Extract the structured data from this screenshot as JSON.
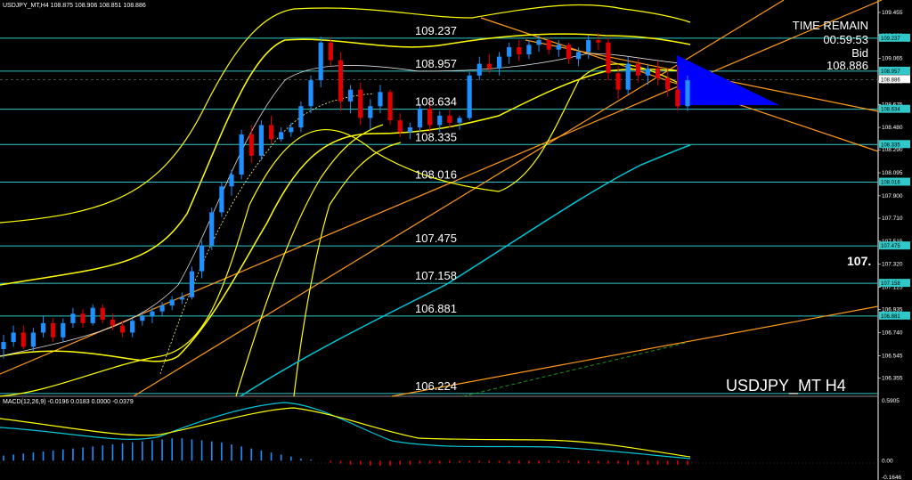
{
  "header": {
    "title": "USDJPY_MT,H4  108.875 108.906 108.851 108.886",
    "macd_label": "MACD(12,26,9) -0.0196 0.0183 0.0000 -0.0379"
  },
  "info_panel": {
    "time_remain_label": "TIME REMAIN",
    "time_remain_value": "00:59:53",
    "bid_label": "Bid",
    "bid_value": "108.886"
  },
  "symbol_watermark": "USDJPY_MT H4",
  "big_label": "107.",
  "colors": {
    "background": "#000000",
    "bull": "#1e90ff",
    "bear": "#e00000",
    "level_line": "#30c8c8",
    "band": "#ffff00",
    "trend": "#ff9a1a",
    "ma_cyan": "#00c8d8",
    "triangle": "#0000ff"
  },
  "chart_data": {
    "type": "line",
    "title": "USDJPY_MT H4",
    "y_range": [
      106.2,
      109.5
    ],
    "macd_range": [
      -0.1646,
      0.5905
    ],
    "price_axis_ticks": [
      "109.455",
      "109.260",
      "109.065",
      "108.870",
      "108.675",
      "108.480",
      "108.290",
      "108.095",
      "107.900",
      "107.710",
      "107.515",
      "107.320",
      "107.125",
      "106.935",
      "106.740",
      "106.545",
      "106.355"
    ],
    "macd_axis_ticks": [
      "0.5905",
      "0.00",
      "-0.1646"
    ],
    "levels": [
      {
        "value": 109.237,
        "label": "109.237",
        "tag": "109.237"
      },
      {
        "value": 108.957,
        "label": "108.957",
        "tag": "108.957"
      },
      {
        "value": 108.634,
        "label": "108.634",
        "tag": "108.634"
      },
      {
        "value": 108.335,
        "label": "108.335",
        "tag": "108.335"
      },
      {
        "value": 108.016,
        "label": "108.016",
        "tag": "108.016"
      },
      {
        "value": 107.475,
        "label": "107.475",
        "tag": "107.475"
      },
      {
        "value": 107.158,
        "label": "107.158",
        "tag": "107.158"
      },
      {
        "value": 106.881,
        "label": "106.881",
        "tag": "106.881"
      },
      {
        "value": 106.224,
        "label": "106.224",
        "tag": ""
      }
    ],
    "bid_tag": "108.886",
    "candles": [
      [
        106.6,
        106.72,
        106.52,
        106.66
      ],
      [
        106.66,
        106.8,
        106.62,
        106.74
      ],
      [
        106.74,
        106.8,
        106.6,
        106.62
      ],
      [
        106.62,
        106.78,
        106.58,
        106.74
      ],
      [
        106.74,
        106.88,
        106.7,
        106.82
      ],
      [
        106.82,
        106.86,
        106.66,
        106.7
      ],
      [
        106.7,
        106.86,
        106.66,
        106.82
      ],
      [
        106.82,
        106.95,
        106.78,
        106.9
      ],
      [
        106.9,
        106.94,
        106.78,
        106.82
      ],
      [
        106.82,
        106.98,
        106.8,
        106.95
      ],
      [
        106.95,
        106.98,
        106.82,
        106.85
      ],
      [
        106.85,
        106.9,
        106.76,
        106.8
      ],
      [
        106.8,
        106.84,
        106.7,
        106.74
      ],
      [
        106.74,
        106.86,
        106.7,
        106.84
      ],
      [
        106.84,
        106.92,
        106.8,
        106.88
      ],
      [
        106.88,
        106.95,
        106.82,
        106.92
      ],
      [
        106.92,
        107.0,
        106.88,
        106.97
      ],
      [
        106.97,
        107.05,
        106.93,
        107.02
      ],
      [
        107.02,
        107.08,
        106.98,
        107.04
      ],
      [
        107.04,
        107.3,
        107.02,
        107.26
      ],
      [
        107.26,
        107.52,
        107.2,
        107.48
      ],
      [
        107.48,
        107.8,
        107.44,
        107.76
      ],
      [
        107.76,
        108.02,
        107.72,
        107.98
      ],
      [
        107.98,
        108.12,
        107.9,
        108.08
      ],
      [
        108.08,
        108.46,
        108.04,
        108.42
      ],
      [
        108.42,
        108.5,
        108.18,
        108.24
      ],
      [
        108.24,
        108.54,
        108.2,
        108.5
      ],
      [
        108.5,
        108.58,
        108.34,
        108.38
      ],
      [
        108.38,
        108.48,
        108.36,
        108.44
      ],
      [
        108.44,
        108.52,
        108.4,
        108.48
      ],
      [
        108.48,
        108.7,
        108.44,
        108.66
      ],
      [
        108.66,
        108.92,
        108.6,
        108.88
      ],
      [
        108.88,
        109.25,
        108.82,
        109.2
      ],
      [
        109.2,
        109.24,
        109.0,
        109.05
      ],
      [
        109.05,
        109.12,
        108.62,
        108.7
      ],
      [
        108.7,
        108.84,
        108.6,
        108.8
      ],
      [
        108.8,
        108.86,
        108.5,
        108.56
      ],
      [
        108.56,
        108.72,
        108.46,
        108.66
      ],
      [
        108.66,
        108.84,
        108.6,
        108.78
      ],
      [
        108.78,
        108.8,
        108.5,
        108.54
      ],
      [
        108.54,
        108.6,
        108.4,
        108.44
      ],
      [
        108.44,
        108.52,
        108.38,
        108.48
      ],
      [
        108.48,
        108.68,
        108.44,
        108.64
      ],
      [
        108.64,
        108.7,
        108.44,
        108.5
      ],
      [
        108.5,
        108.62,
        108.44,
        108.58
      ],
      [
        108.58,
        108.64,
        108.48,
        108.52
      ],
      [
        108.52,
        108.58,
        108.46,
        108.56
      ],
      [
        108.56,
        108.95,
        108.54,
        108.92
      ],
      [
        108.92,
        109.08,
        108.88,
        109.02
      ],
      [
        109.02,
        109.1,
        108.94,
        108.98
      ],
      [
        108.98,
        109.12,
        108.92,
        109.08
      ],
      [
        109.08,
        109.2,
        109.02,
        109.16
      ],
      [
        109.16,
        109.22,
        109.04,
        109.1
      ],
      [
        109.1,
        109.22,
        109.06,
        109.18
      ],
      [
        109.18,
        109.26,
        109.12,
        109.22
      ],
      [
        109.22,
        109.24,
        109.1,
        109.14
      ],
      [
        109.14,
        109.22,
        109.08,
        109.18
      ],
      [
        109.18,
        109.2,
        109.02,
        109.06
      ],
      [
        109.06,
        109.16,
        109.0,
        109.12
      ],
      [
        109.12,
        109.26,
        109.06,
        109.22
      ],
      [
        109.22,
        109.28,
        109.14,
        109.2
      ],
      [
        109.2,
        109.24,
        108.88,
        108.94
      ],
      [
        108.94,
        109.0,
        108.72,
        108.8
      ],
      [
        108.8,
        109.08,
        108.76,
        109.02
      ],
      [
        109.02,
        109.06,
        108.86,
        108.92
      ],
      [
        108.92,
        109.02,
        108.84,
        108.98
      ],
      [
        108.98,
        109.04,
        108.84,
        108.9
      ],
      [
        108.9,
        108.98,
        108.74,
        108.8
      ],
      [
        108.8,
        109.0,
        108.62,
        108.66
      ],
      [
        108.66,
        108.92,
        108.62,
        108.88
      ]
    ],
    "macd_hist": [
      0.05,
      0.06,
      0.07,
      0.08,
      0.09,
      0.1,
      0.11,
      0.12,
      0.13,
      0.14,
      0.15,
      0.16,
      0.17,
      0.18,
      0.19,
      0.2,
      0.21,
      0.22,
      0.22,
      0.21,
      0.2,
      0.19,
      0.18,
      0.16,
      0.14,
      0.12,
      0.1,
      0.08,
      0.06,
      0.04,
      0.02,
      0.01,
      0.0,
      -0.02,
      -0.03,
      -0.04,
      -0.04,
      -0.05,
      -0.05,
      -0.05,
      -0.04,
      -0.04,
      -0.03,
      -0.03,
      -0.03,
      -0.02,
      -0.02,
      -0.02,
      -0.02,
      -0.02,
      -0.02,
      -0.03,
      -0.03,
      -0.03,
      -0.03,
      -0.02,
      -0.02,
      -0.02,
      -0.03,
      -0.03,
      -0.03,
      -0.03,
      -0.03,
      -0.04,
      -0.04,
      -0.04,
      -0.04,
      -0.04,
      -0.04,
      -0.04
    ]
  }
}
